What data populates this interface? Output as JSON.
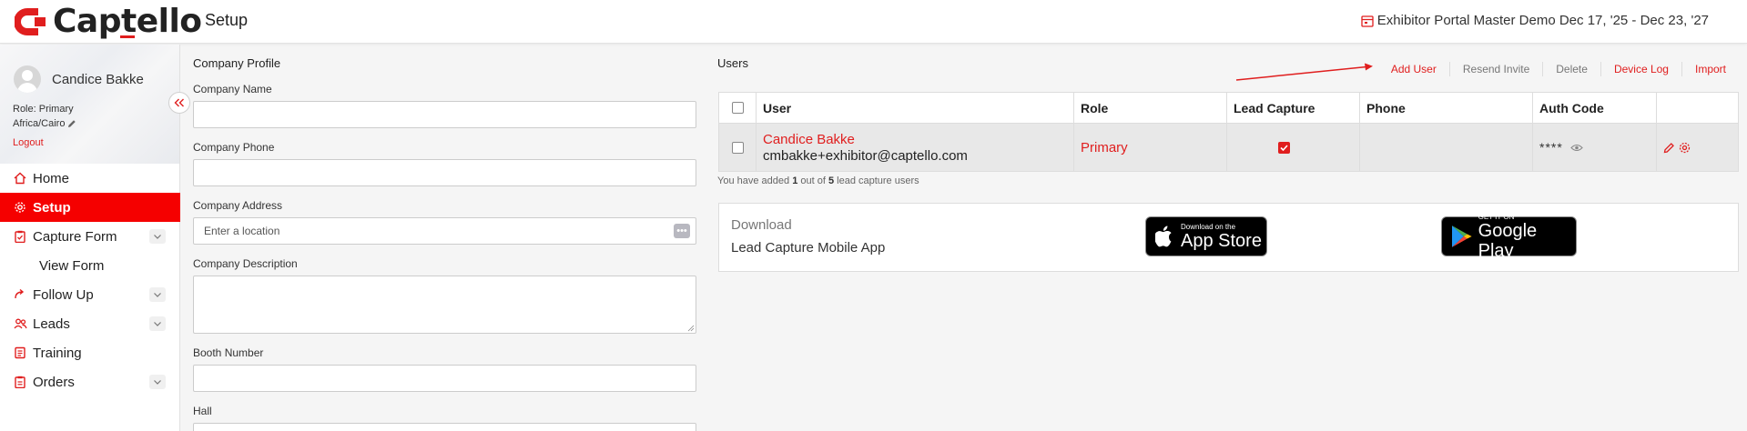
{
  "header": {
    "logo_text": "Captello",
    "page_title": "Setup",
    "event_info": "Exhibitor Portal Master Demo Dec 17, '25 - Dec 23, '27"
  },
  "profile": {
    "name": "Candice Bakke",
    "role": "Role: Primary",
    "timezone": "Africa/Cairo",
    "logout": "Logout"
  },
  "nav": {
    "home": "Home",
    "setup": "Setup",
    "capture_form": "Capture Form",
    "view_form": "View Form",
    "follow_up": "Follow Up",
    "leads": "Leads",
    "training": "Training",
    "orders": "Orders"
  },
  "company": {
    "title": "Company Profile",
    "name_label": "Company Name",
    "name_value": "",
    "phone_label": "Company Phone",
    "phone_value": "",
    "address_label": "Company Address",
    "address_placeholder": "Enter a location",
    "description_label": "Company Description",
    "booth_label": "Booth Number",
    "hall_label": "Hall"
  },
  "users": {
    "title": "Users",
    "actions": {
      "add_user": "Add User",
      "resend_invite": "Resend Invite",
      "delete": "Delete",
      "device_log": "Device Log",
      "import": "Import"
    },
    "columns": {
      "user": "User",
      "role": "Role",
      "lead_capture": "Lead Capture",
      "phone": "Phone",
      "auth_code": "Auth Code"
    },
    "rows": [
      {
        "name": "Candice Bakke",
        "email": "cmbakke+exhibitor@captello.com",
        "role": "Primary",
        "lead_capture": true,
        "phone": "",
        "auth_code": "****"
      }
    ],
    "note_prefix": "You have added ",
    "note_count": "1",
    "note_middle": " out of ",
    "note_total": "5",
    "note_suffix": " lead capture users"
  },
  "download": {
    "title": "Download",
    "subtitle": "Lead Capture Mobile App",
    "appstore_small": "Download on the",
    "appstore_big": "App Store",
    "gplay_small": "GET IT ON",
    "gplay_big": "Google Play"
  },
  "colors": {
    "accent": "#e01e1e",
    "active_nav": "#f50000"
  }
}
